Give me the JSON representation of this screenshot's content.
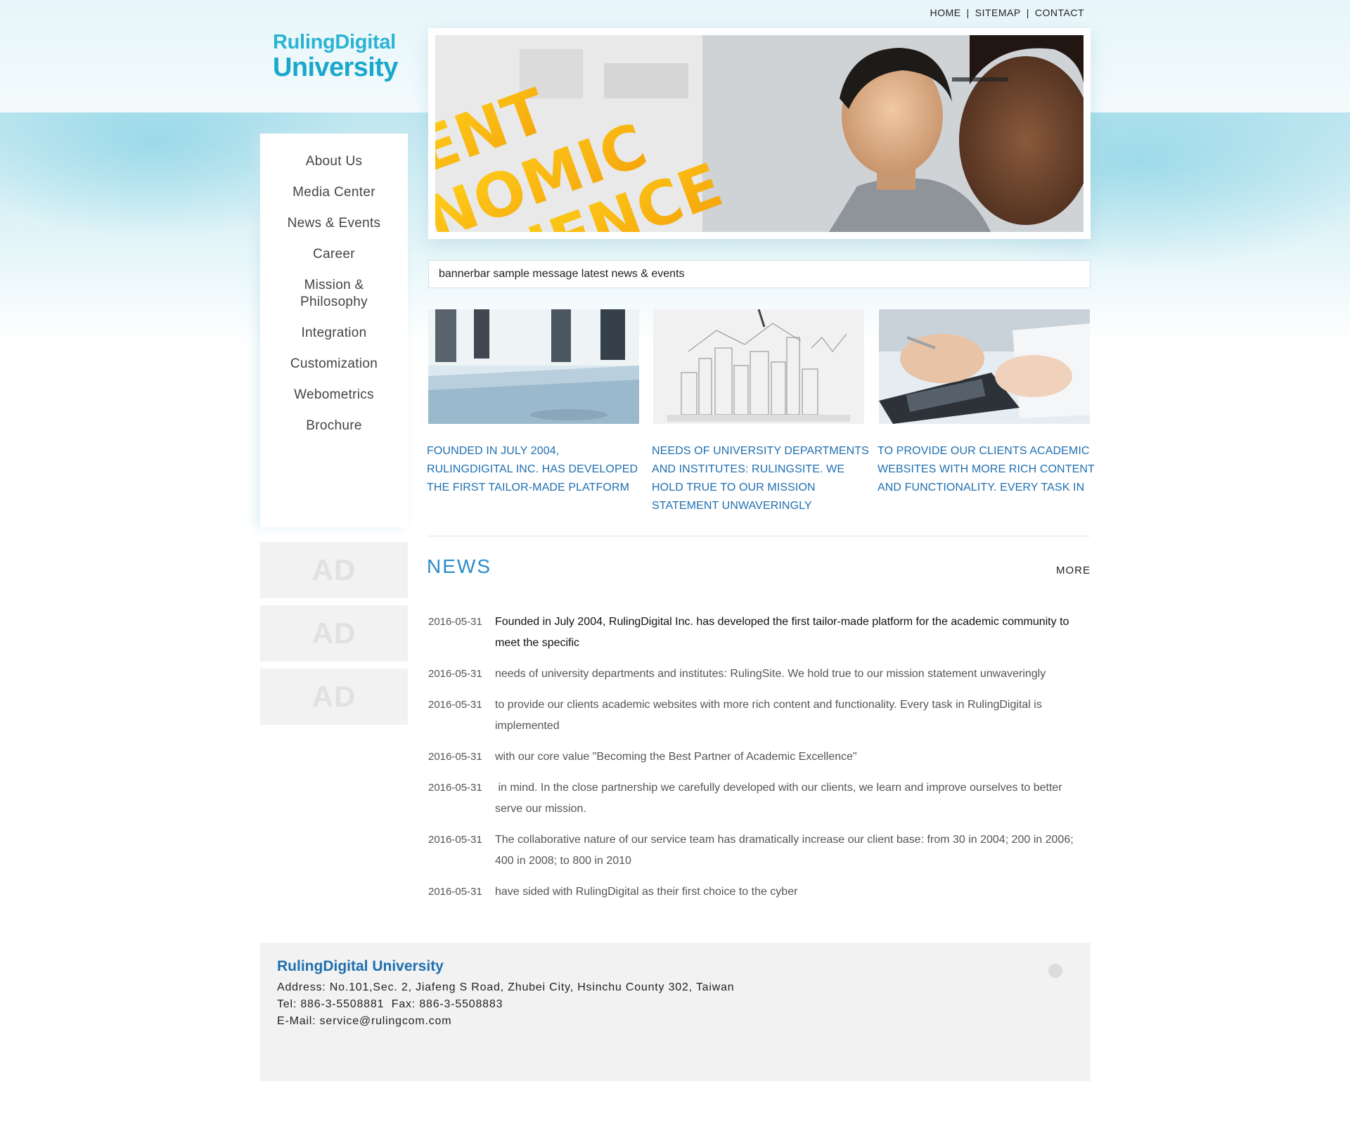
{
  "top_nav": {
    "home": "HOME",
    "sitemap": "SITEMAP",
    "contact": "CONTACT",
    "sep": "|"
  },
  "logo": {
    "line1": "RulingDigital",
    "line2": "University"
  },
  "banner": {
    "words": [
      "ENT",
      "NOMIC",
      "CIENCE"
    ]
  },
  "side_menu": {
    "items": [
      {
        "label": "About Us"
      },
      {
        "label": "Media Center"
      },
      {
        "label": "News & Events"
      },
      {
        "label": "Career"
      },
      {
        "label": "Mission & Philosophy"
      },
      {
        "label": "Integration"
      },
      {
        "label": "Customization"
      },
      {
        "label": "Webometrics"
      },
      {
        "label": "Brochure"
      }
    ]
  },
  "ads": [
    "AD",
    "AD",
    "AD"
  ],
  "bannerbar": {
    "text": "bannerbar sample message latest news & events"
  },
  "features": [
    {
      "caption": "FOUNDED IN JULY 2004, RULINGDIGITAL INC. HAS DEVELOPED THE FIRST TAILOR-MADE PLATFORM",
      "image": "office-meeting-photo"
    },
    {
      "caption": "NEEDS OF UNIVERSITY DEPARTMENTS AND INSTITUTES: RULINGSITE. WE HOLD TRUE TO OUR MISSION STATEMENT UNWAVERINGLY",
      "image": "city-sketch-photo"
    },
    {
      "caption": "TO PROVIDE OUR CLIENTS ACADEMIC WEBSITES WITH MORE RICH CONTENT AND FUNCTIONALITY. EVERY TASK IN",
      "image": "calculator-laptop-photo"
    }
  ],
  "news": {
    "title": "NEWS",
    "more": "MORE",
    "items": [
      {
        "date": "2016-05-31",
        "text": "Founded in July 2004, RulingDigital Inc. has developed the first tailor-made platform for the academic community to meet the specific"
      },
      {
        "date": "2016-05-31",
        "text": "needs of university departments and institutes: RulingSite. We hold true to our mission statement unwaveringly"
      },
      {
        "date": "2016-05-31",
        "text": "to provide our clients academic websites with more rich content and functionality. Every task in RulingDigital is implemented"
      },
      {
        "date": "2016-05-31",
        "text": "with our core value \"Becoming the Best Partner of Academic Excellence\""
      },
      {
        "date": "2016-05-31",
        "text": " in mind. In the close partnership we carefully developed with our clients, we learn and improve ourselves to better serve our mission."
      },
      {
        "date": "2016-05-31",
        "text": "The collaborative nature of our service team has dramatically increase our client base: from 30 in 2004; 200 in 2006; 400 in 2008; to 800 in 2010"
      },
      {
        "date": "2016-05-31",
        "text": "have sided with RulingDigital as their first choice to the cyber"
      }
    ]
  },
  "footer": {
    "name": "RulingDigital University",
    "address": "Address: No.101,Sec. 2, Jiafeng S Road, Zhubei City, Hsinchu County 302, Taiwan",
    "phone": "Tel: 886-3-5508881  Fax: 886-3-5508883",
    "email": "E-Mail: service@rulingcom.com",
    "icon": "mail-icon"
  },
  "colors": {
    "accent": "#1f6fb0",
    "logo": "#1aa7cc",
    "news_title": "#2a8ccc"
  }
}
